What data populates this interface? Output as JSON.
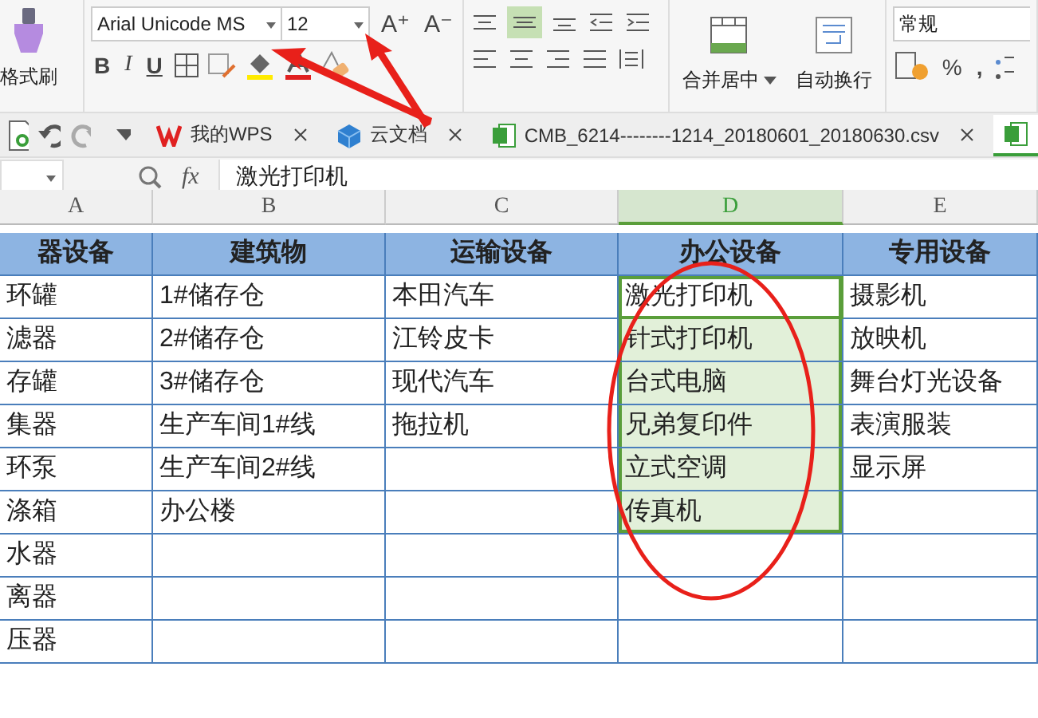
{
  "ribbon": {
    "clipboard": {
      "format_painter": "格式刷"
    },
    "font": {
      "family": "Arial Unicode MS",
      "size": "12",
      "size_buttons": [
        "A⁺",
        "A⁻"
      ],
      "style_buttons": [
        "B",
        "I",
        "U"
      ]
    },
    "merge": {
      "label": "合并居中"
    },
    "wrap": {
      "label": "自动换行"
    },
    "number": {
      "format": "常规",
      "percent": "%",
      "comma": ","
    }
  },
  "tab_bar": {
    "tabs": [
      {
        "kind": "wps",
        "label": "我的WPS",
        "selected": false
      },
      {
        "kind": "cloud",
        "label": "云文档",
        "selected": false
      },
      {
        "kind": "sheet",
        "label": "CMB_6214--------1214_20180601_20180630.csv",
        "selected": false
      },
      {
        "kind": "sheet",
        "selected": true
      }
    ]
  },
  "formula_bar": {
    "fx": "fx",
    "value": "激光打印机"
  },
  "table": {
    "columns": [
      {
        "letter": "A",
        "selected": false
      },
      {
        "letter": "B",
        "selected": false
      },
      {
        "letter": "C",
        "selected": false
      },
      {
        "letter": "D",
        "selected": true
      },
      {
        "letter": "E",
        "selected": false
      }
    ],
    "header_row": [
      "器设备",
      "建筑物",
      "运输设备",
      "办公设备",
      "专用设备"
    ],
    "rows": [
      {
        "cells": [
          {
            "text": "环罐",
            "selected": false,
            "active": false
          },
          {
            "text": "1#储存仓",
            "selected": false,
            "active": false
          },
          {
            "text": "本田汽车",
            "selected": false,
            "active": false
          },
          {
            "text": "激光打印机",
            "selected": true,
            "active": true
          },
          {
            "text": "摄影机",
            "selected": false,
            "active": false
          }
        ]
      },
      {
        "cells": [
          {
            "text": "滤器",
            "selected": false,
            "active": false
          },
          {
            "text": "2#储存仓",
            "selected": false,
            "active": false
          },
          {
            "text": "江铃皮卡",
            "selected": false,
            "active": false
          },
          {
            "text": "针式打印机",
            "selected": true,
            "active": false
          },
          {
            "text": "放映机",
            "selected": false,
            "active": false
          }
        ]
      },
      {
        "cells": [
          {
            "text": "存罐",
            "selected": false,
            "active": false
          },
          {
            "text": "3#储存仓",
            "selected": false,
            "active": false
          },
          {
            "text": "现代汽车",
            "selected": false,
            "active": false
          },
          {
            "text": "台式电脑",
            "selected": true,
            "active": false
          },
          {
            "text": "舞台灯光设备",
            "selected": false,
            "active": false
          }
        ]
      },
      {
        "cells": [
          {
            "text": "集器",
            "selected": false,
            "active": false
          },
          {
            "text": "生产车间1#线",
            "selected": false,
            "active": false
          },
          {
            "text": "拖拉机",
            "selected": false,
            "active": false
          },
          {
            "text": "兄弟复印件",
            "selected": true,
            "active": false
          },
          {
            "text": "表演服装",
            "selected": false,
            "active": false
          }
        ]
      },
      {
        "cells": [
          {
            "text": "环泵",
            "selected": false,
            "active": false
          },
          {
            "text": "生产车间2#线",
            "selected": false,
            "active": false
          },
          {
            "text": "",
            "selected": false,
            "active": false
          },
          {
            "text": "立式空调",
            "selected": true,
            "active": false
          },
          {
            "text": "显示屏",
            "selected": false,
            "active": false
          }
        ]
      },
      {
        "cells": [
          {
            "text": "涤箱",
            "selected": false,
            "active": false
          },
          {
            "text": "办公楼",
            "selected": false,
            "active": false
          },
          {
            "text": "",
            "selected": false,
            "active": false
          },
          {
            "text": "传真机",
            "selected": true,
            "active": false
          },
          {
            "text": "",
            "selected": false,
            "active": false
          }
        ]
      },
      {
        "cells": [
          {
            "text": "水器",
            "selected": false,
            "active": false
          },
          {
            "text": "",
            "selected": false,
            "active": false
          },
          {
            "text": "",
            "selected": false,
            "active": false
          },
          {
            "text": "",
            "selected": false,
            "active": false
          },
          {
            "text": "",
            "selected": false,
            "active": false
          }
        ]
      },
      {
        "cells": [
          {
            "text": "离器",
            "selected": false,
            "active": false
          },
          {
            "text": "",
            "selected": false,
            "active": false
          },
          {
            "text": "",
            "selected": false,
            "active": false
          },
          {
            "text": "",
            "selected": false,
            "active": false
          },
          {
            "text": "",
            "selected": false,
            "active": false
          }
        ]
      },
      {
        "cells": [
          {
            "text": "压器",
            "selected": false,
            "active": false
          },
          {
            "text": "",
            "selected": false,
            "active": false
          },
          {
            "text": "",
            "selected": false,
            "active": false
          },
          {
            "text": "",
            "selected": false,
            "active": false
          },
          {
            "text": "",
            "selected": false,
            "active": false
          }
        ]
      }
    ]
  }
}
